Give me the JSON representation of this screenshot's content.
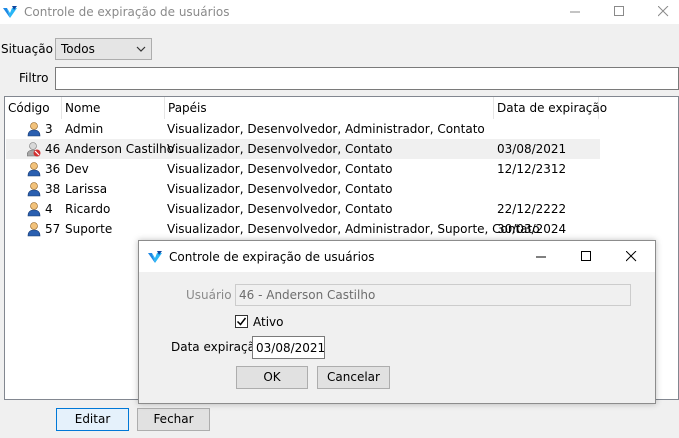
{
  "window": {
    "title": "Controle de expiração de usuários"
  },
  "filters": {
    "situacao_label": "Situação",
    "situacao_value": "Todos",
    "filtro_label": "Filtro",
    "filtro_value": ""
  },
  "list": {
    "columns": [
      "Código",
      "Nome",
      "Papéis",
      "Data de expiração"
    ],
    "rows": [
      {
        "codigo": "3",
        "nome": "Admin",
        "papeis": "Visualizador, Desenvolvedor, Administrador, Contato",
        "data": "",
        "icon": "user-icon"
      },
      {
        "codigo": "46",
        "nome": "Anderson Castilho",
        "papeis": "Visualizador, Desenvolvedor, Contato",
        "data": "03/08/2021",
        "icon": "user-blocked-icon"
      },
      {
        "codigo": "36",
        "nome": "Dev",
        "papeis": "Visualizador, Desenvolvedor, Contato",
        "data": "12/12/2312",
        "icon": "user-icon"
      },
      {
        "codigo": "38",
        "nome": "Larissa",
        "papeis": "Visualizador, Desenvolvedor, Contato",
        "data": "",
        "icon": "user-icon"
      },
      {
        "codigo": "4",
        "nome": "Ricardo",
        "papeis": "Visualizador, Desenvolvedor, Contato",
        "data": "22/12/2222",
        "icon": "user-icon"
      },
      {
        "codigo": "57",
        "nome": "Suporte",
        "papeis": "Visualizador, Desenvolvedor, Administrador, Suporte, Contato",
        "data": "30/03/2024",
        "icon": "user-icon"
      }
    ]
  },
  "buttons": {
    "editar": "Editar",
    "fechar": "Fechar"
  },
  "dialog": {
    "title": "Controle de expiração de usuários",
    "usuario_label": "Usuário",
    "usuario_value": "46 - Anderson Castilho",
    "ativo_label": "Ativo",
    "ativo_checked": true,
    "data_label": "Data expiração",
    "data_value": "03/08/2021",
    "ok_label": "OK",
    "cancel_label": "Cancelar"
  },
  "colors": {
    "accent": "#0078d7",
    "icon_blue": "#2a5fb0",
    "icon_skin": "#f2c27b",
    "blocked_red": "#d32f2f"
  }
}
